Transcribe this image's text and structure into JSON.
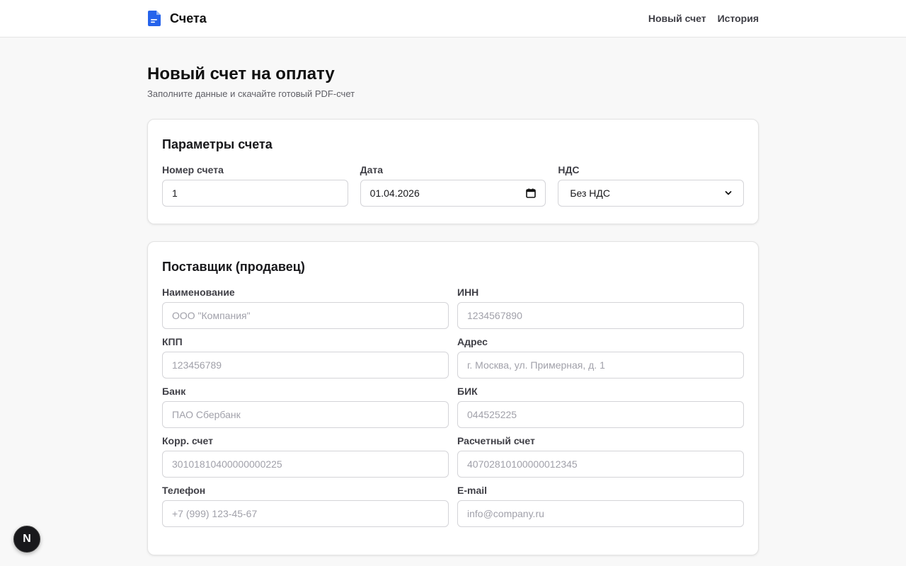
{
  "app": {
    "brand": "Счета",
    "nav": [
      "Новый счет",
      "История"
    ]
  },
  "page": {
    "title": "Новый счет на оплату",
    "subtitle": "Заполните данные и скачайте готовый PDF-счет"
  },
  "params": {
    "title": "Параметры счета",
    "number": {
      "label": "Номер счета",
      "value": "1"
    },
    "date": {
      "label": "Дата",
      "value": "01.04.2026"
    },
    "vat": {
      "label": "НДС",
      "value": "Без НДС"
    }
  },
  "supplier": {
    "title": "Поставщик (продавец)",
    "fields": [
      {
        "label": "Наименование",
        "placeholder": "ООО \"Компания\""
      },
      {
        "label": "ИНН",
        "placeholder": "1234567890"
      },
      {
        "label": "КПП",
        "placeholder": "123456789"
      },
      {
        "label": "Адрес",
        "placeholder": "г. Москва, ул. Примерная, д. 1"
      },
      {
        "label": "Банк",
        "placeholder": "ПАО Сбербанк"
      },
      {
        "label": "БИК",
        "placeholder": "044525225"
      },
      {
        "label": "Корр. счет",
        "placeholder": "30101810400000000225"
      },
      {
        "label": "Расчетный счет",
        "placeholder": "40702810100000012345"
      },
      {
        "label": "Телефон",
        "placeholder": "+7 (999) 123-45-67"
      },
      {
        "label": "E-mail",
        "placeholder": "info@company.ru"
      }
    ]
  },
  "devtools": {
    "badge": "N"
  },
  "colors": {
    "accent": "#2563eb",
    "background": "#f8f8f8"
  }
}
